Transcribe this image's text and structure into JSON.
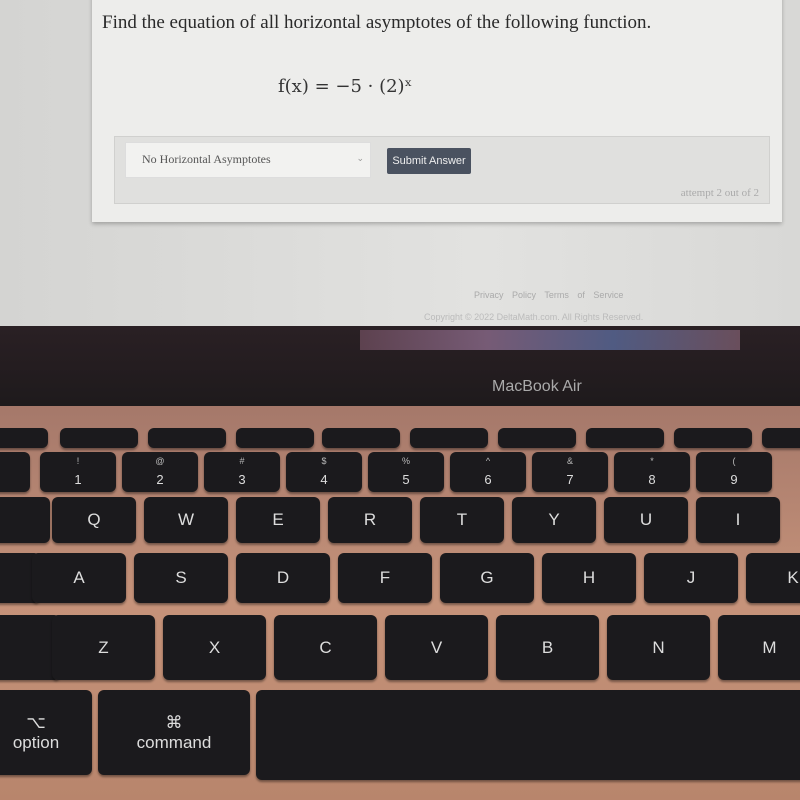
{
  "question": {
    "prompt": "Find the equation of all horizontal asymptotes of the following function.",
    "equation": "f(x) = −5 · (2)ˣ"
  },
  "answer": {
    "selected": "No Horizontal Asymptotes",
    "submit_label": "Submit Answer",
    "attempt": "attempt 2 out of 2"
  },
  "footer": {
    "privacy": "Privacy Policy",
    "terms": "Terms of Service",
    "copyright": "Copyright © 2022 DeltaMath.com. All Rights Reserved."
  },
  "laptop": {
    "brand": "MacBook Air"
  },
  "keyboard": {
    "number_row": [
      {
        "main": "1",
        "shift": "!"
      },
      {
        "main": "2",
        "shift": "@"
      },
      {
        "main": "3",
        "shift": "#"
      },
      {
        "main": "4",
        "shift": "$"
      },
      {
        "main": "5",
        "shift": "%"
      },
      {
        "main": "6",
        "shift": "^"
      },
      {
        "main": "7",
        "shift": "&"
      },
      {
        "main": "8",
        "shift": "*"
      },
      {
        "main": "9",
        "shift": "("
      }
    ],
    "q_row": [
      "Q",
      "W",
      "E",
      "R",
      "T",
      "Y",
      "U",
      "I"
    ],
    "a_row": [
      "A",
      "S",
      "D",
      "F",
      "G",
      "H",
      "J",
      "K"
    ],
    "z_row": [
      "Z",
      "X",
      "C",
      "V",
      "B",
      "N",
      "M"
    ],
    "option": {
      "label": "option",
      "symbol": "⌥"
    },
    "command": {
      "label": "command",
      "symbol": "⌘"
    }
  }
}
